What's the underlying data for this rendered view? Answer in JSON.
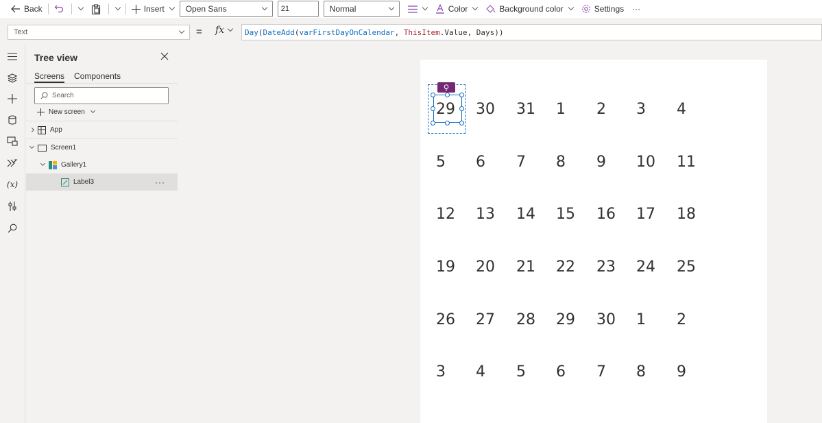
{
  "toolbar": {
    "back_label": "Back",
    "insert_label": "Insert",
    "font_family": "Open Sans",
    "font_size": "21",
    "font_weight": "Normal",
    "color_label": "Color",
    "background_color_label": "Background color",
    "settings_label": "Settings",
    "more_label": "···"
  },
  "formula_bar": {
    "property": "Text",
    "equals": "=",
    "fx": "fx",
    "tokens": [
      {
        "text": "Day",
        "kind": "fn"
      },
      {
        "text": "(",
        "kind": "plain"
      },
      {
        "text": "DateAdd",
        "kind": "fn"
      },
      {
        "text": "(",
        "kind": "plain"
      },
      {
        "text": "varFirstDayOnCalendar",
        "kind": "var"
      },
      {
        "text": ", ",
        "kind": "plain"
      },
      {
        "text": "ThisItem",
        "kind": "kw"
      },
      {
        "text": ".Value, Days))",
        "kind": "plain"
      }
    ]
  },
  "tree_view": {
    "title": "Tree view",
    "tabs": [
      "Screens",
      "Components"
    ],
    "search_placeholder": "Search",
    "new_screen_label": "New screen",
    "nodes": [
      {
        "label": "App"
      },
      {
        "label": "Screen1"
      },
      {
        "label": "Gallery1"
      },
      {
        "label": "Label3"
      }
    ],
    "more_label": "···"
  },
  "calendar": {
    "rows": [
      [
        "29",
        "30",
        "31",
        "1",
        "2",
        "3",
        "4"
      ],
      [
        "5",
        "6",
        "7",
        "8",
        "9",
        "10",
        "11"
      ],
      [
        "12",
        "13",
        "14",
        "15",
        "16",
        "17",
        "18"
      ],
      [
        "19",
        "20",
        "21",
        "22",
        "23",
        "24",
        "25"
      ],
      [
        "26",
        "27",
        "28",
        "29",
        "30",
        "1",
        "2"
      ],
      [
        "3",
        "4",
        "5",
        "6",
        "7",
        "8",
        "9"
      ]
    ]
  },
  "colors": {
    "accent": "#0f6cbd",
    "badge": "#742774",
    "keyword": "#a4262c"
  }
}
